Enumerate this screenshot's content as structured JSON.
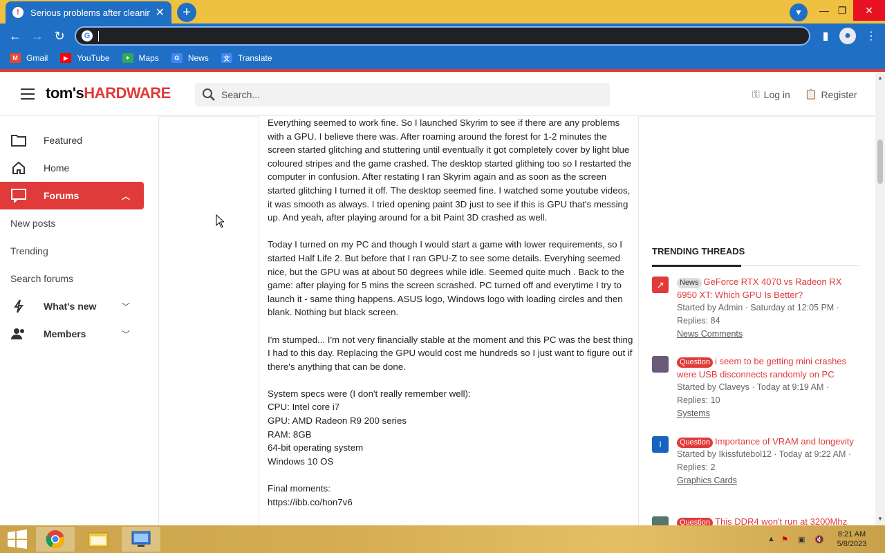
{
  "browser": {
    "tab_title": "Serious problems after cleaning c",
    "tab_close": "✕",
    "new_tab": "+",
    "url": "",
    "bookmarks": [
      {
        "label": "Gmail",
        "icon": "gmail-icon",
        "color": "#ea4335"
      },
      {
        "label": "YouTube",
        "icon": "youtube-icon",
        "color": "#ff0000"
      },
      {
        "label": "Maps",
        "icon": "maps-icon",
        "color": "#34a853"
      },
      {
        "label": "News",
        "icon": "news-icon",
        "color": "#4285f4"
      },
      {
        "label": "Translate",
        "icon": "translate-icon",
        "color": "#4285f4"
      }
    ]
  },
  "header": {
    "logo_main": "tom's",
    "logo_accent": "HARDWARE",
    "search_placeholder": "Search...",
    "login": "Log in",
    "register": "Register"
  },
  "sidebar": {
    "items": [
      {
        "label": "Featured"
      },
      {
        "label": "Home"
      },
      {
        "label": "Forums"
      },
      {
        "label": "New posts"
      },
      {
        "label": "Trending"
      },
      {
        "label": "Search forums"
      },
      {
        "label": "What's new"
      },
      {
        "label": "Members"
      }
    ]
  },
  "post": {
    "paragraphs": [
      "Everything seemed to work fine. So I launched Skyrim to see if there are any problems with a GPU. I believe there was. After roaming around the forest for 1-2 minutes the screen started glitching and stuttering until eventually it got completely cover by light blue coloured stripes and the game crashed. The desktop started glithing too so I restarted the computer in confusion. After restating I ran Skyrim again and as soon as the screen started glitching I turned it off. The desktop seemed fine. I watched some youtube videos, it was smooth as always. I tried opening paint 3D just to see if this is GPU that's messing up. And yeah, after playing around for a bit Paint 3D crashed as well.",
      "Today I turned on my PC and though I would start a game with lower requirements, so I started Half Life 2. But before that I ran GPU-Z to see some details. Everyhing seemed nice, but the GPU was at about 50 degrees while idle. Seemed quite much . Back to the game: after playing for 5 mins the screen scrashed. PC turned off and everytime I try to launch it - same thing happens. ASUS logo, Windows logo with loading circles and then blank. Nothing but black screen.",
      "I'm stumped... I'm not very financially stable at the moment and this PC was the best thing I had to this day. Replacing the GPU would cost me hundreds so I just want to figure out if there's anything that can be done."
    ],
    "specs": [
      "System specs were (I don't really remember well):",
      "CPU: Intel core i7",
      "GPU: AMD Radeon R9 200 series",
      "RAM: 8GB",
      "64-bit operating system",
      "Windows 10 OS"
    ],
    "final_label": "Final moments:",
    "final_link": "https://ibb.co/hon7v6"
  },
  "trending": {
    "heading": "TRENDING THREADS",
    "threads": [
      {
        "tag": "News",
        "title": "GeForce RTX 4070 vs Radeon RX 6950 XT: Which GPU Is Better?",
        "meta": "Started by Admin · Saturday at 12:05 PM ·",
        "replies": "Replies: 84",
        "forum": "News Comments"
      },
      {
        "tag": "Question",
        "title": "i seem to be getting mini crashes were USB disconnects randomly on PC",
        "meta": "Started by Claveys · Today at 9:19 AM ·",
        "replies": "Replies: 10",
        "forum": "Systems"
      },
      {
        "tag": "Question",
        "title": "Importance of VRAM and longevity",
        "meta": "Started by Ikissfutebol12 · Today at 9:22 AM ·",
        "replies": "Replies: 2",
        "forum": "Graphics Cards"
      },
      {
        "tag": "Question",
        "title": "This DDR4 won't run at 3200Mhz",
        "meta": "",
        "replies": "",
        "forum": ""
      }
    ],
    "avatar_letter": "I"
  },
  "taskbar": {
    "time": "8:21 AM",
    "date": "5/8/2023"
  },
  "colors": {
    "accent_red": "#e03a3a",
    "chrome_blue": "#1f6fc5",
    "tabstrip_yellow": "#f0c040"
  }
}
